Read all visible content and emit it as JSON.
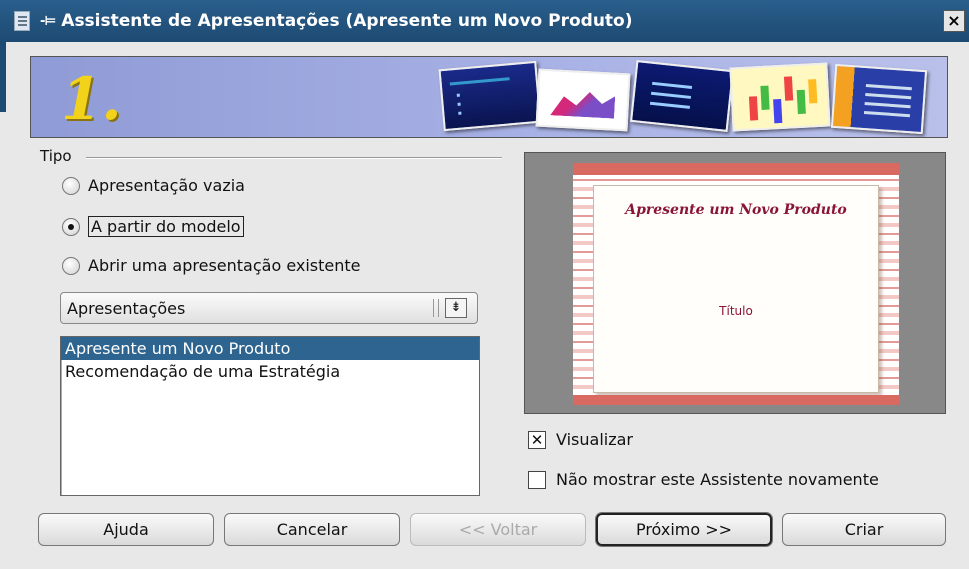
{
  "window": {
    "title": "Assistente de Apresentações (Apresente um Novo Produto)",
    "close_label": "×",
    "close_icon": "close-icon",
    "app_icon": "document-icon",
    "pin_icon": "pin-icon"
  },
  "banner": {
    "step_number": "1."
  },
  "tipo_group": {
    "label": "Tipo",
    "options": [
      {
        "label": "Apresentação vazia",
        "checked": false
      },
      {
        "label": "A partir do modelo",
        "checked": true
      },
      {
        "label": "Abrir uma apresentação existente",
        "checked": false
      }
    ]
  },
  "category_select": {
    "value": "Apresentações",
    "arrow": "⇟"
  },
  "template_list": {
    "items": [
      {
        "label": "Apresente um Novo Produto",
        "selected": true
      },
      {
        "label": "Recomendação de uma Estratégia",
        "selected": false
      }
    ]
  },
  "preview": {
    "slide_title": "Apresente um Novo Produto",
    "slide_subtitle": "Título"
  },
  "options": {
    "visualizar_label": "Visualizar",
    "visualizar_checked": true,
    "visualizar_mark": "✕",
    "nao_mostrar_label": "Não mostrar este Assistente novamente",
    "nao_mostrar_checked": false
  },
  "buttons": {
    "ajuda": "Ajuda",
    "cancelar": "Cancelar",
    "voltar": "<< Voltar",
    "proximo": "Próximo >>",
    "criar": "Criar"
  },
  "colors": {
    "titlebar": "#2a5f8c",
    "selection": "#2d6590",
    "banner": "#aab3e6"
  }
}
